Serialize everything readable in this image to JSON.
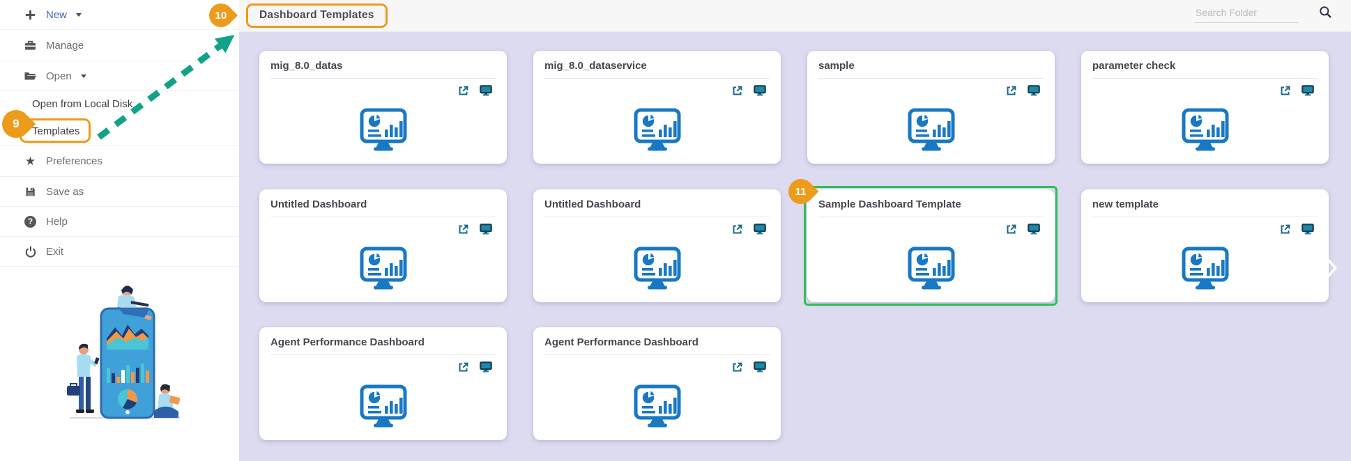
{
  "header": {
    "title": "Dashboard Templates",
    "search_placeholder": "Search Folder"
  },
  "sidebar": {
    "items": [
      {
        "label": "New"
      },
      {
        "label": "Manage"
      },
      {
        "label": "Open"
      },
      {
        "label": "Open from Local Disk"
      },
      {
        "label": "Templates"
      },
      {
        "label": "Preferences"
      },
      {
        "label": "Save as"
      },
      {
        "label": "Help"
      },
      {
        "label": "Exit"
      }
    ],
    "star_glyph": "★",
    "help_glyph": "?"
  },
  "cards": [
    {
      "title": "mig_8.0_datas"
    },
    {
      "title": "mig_8.0_dataservice"
    },
    {
      "title": "sample"
    },
    {
      "title": "parameter check"
    },
    {
      "title": "Untitled Dashboard"
    },
    {
      "title": "Untitled Dashboard"
    },
    {
      "title": "Sample Dashboard Template"
    },
    {
      "title": "new template"
    },
    {
      "title": "Agent Performance Dashboard"
    },
    {
      "title": "Agent Performance Dashboard"
    }
  ],
  "annotations": {
    "badge_9": "9",
    "badge_10": "10",
    "badge_11": "11",
    "highlight_orange": "#ED9B1A",
    "highlight_green": "#2BC155",
    "arrow_teal": "#12A287"
  },
  "colors": {
    "card_icon_blue": "#1878C4",
    "action_icon_teal": "#17678A",
    "background_lavender": "#DCDBF0",
    "topbar_gray": "#F7F7F8"
  }
}
